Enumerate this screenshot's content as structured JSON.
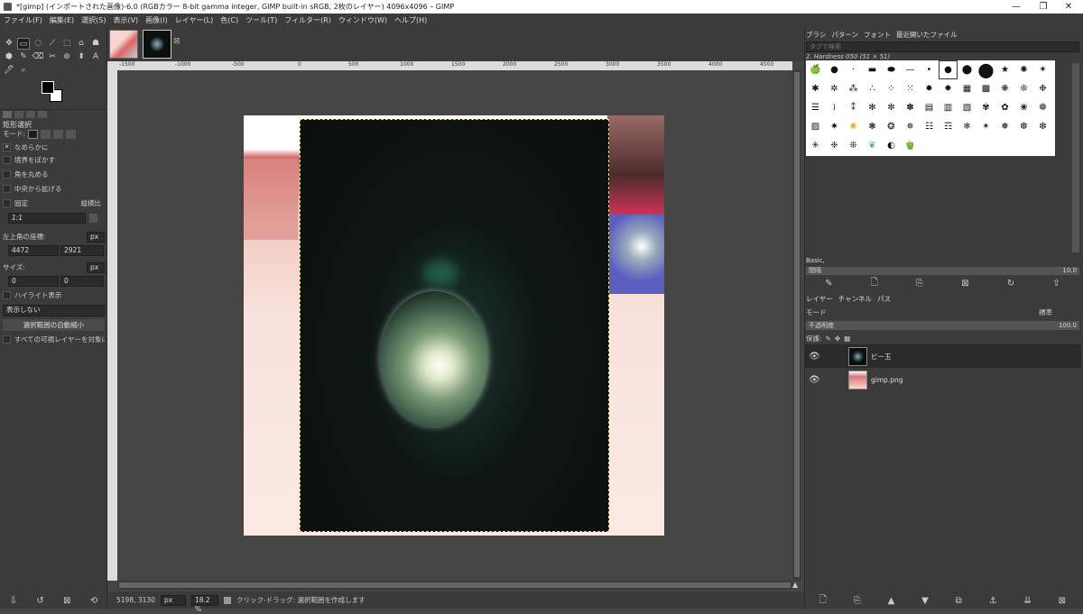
{
  "window": {
    "title": "*[gimp] (インポートされた画像)-6.0 (RGBカラー 8-bit gamma integer, GIMP built-in sRGB, 2枚のレイヤー) 4096x4096 – GIMP",
    "minimize": "—",
    "maximize": "❐",
    "close": "✕"
  },
  "menu": [
    "ファイル(F)",
    "編集(E)",
    "選択(S)",
    "表示(V)",
    "画像(I)",
    "レイヤー(L)",
    "色(C)",
    "ツール(T)",
    "フィルター(R)",
    "ウィンドウ(W)",
    "ヘルプ(H)"
  ],
  "toolbox": {
    "tools": [
      "✥",
      "▭",
      "◌",
      "⟋",
      "⬚",
      "⌂",
      "☗",
      "⬢",
      "✎",
      "⌫",
      "✂",
      "⊛",
      "⬍",
      "A",
      "🖊",
      "⌕"
    ],
    "options_title": "矩形選択",
    "mode_label": "モード:",
    "antialias": "なめらかに",
    "feather": "境界をぼかす",
    "rounded": "角を丸める",
    "expand_center": "中央から拡げる",
    "fixed": "固定",
    "fixed_value": "縦横比",
    "ratio": "1:1",
    "position_label": "左上角の座標:",
    "unit": "px",
    "pos_x": "4472",
    "pos_y": "2921",
    "size_label": "サイズ:",
    "size_w": "0",
    "size_h": "0",
    "highlight": "ハイライト表示",
    "guides": "表示しない",
    "auto_shrink": "選択範囲の自動縮小",
    "sample_merged": "すべての可視レイヤーを対象にす"
  },
  "rulers": {
    "h_ticks": [
      "-1500",
      "-1000",
      "-500",
      "0",
      "500",
      "1000",
      "1500",
      "2000",
      "2500",
      "3000",
      "3500",
      "4000",
      "4500",
      "5000"
    ]
  },
  "status": {
    "coords": "5198, 3130",
    "unit": "px",
    "zoom": "18.2 %",
    "message": "クリック-ドラッグ: 選択範囲を作成します"
  },
  "dock": {
    "tabs": [
      "ブラシ",
      "パターン",
      "フォント",
      "最近開いたファイル"
    ],
    "tag_placeholder": "タグで検索",
    "brush_name": "2. Hardness 050 (51 × 51)",
    "preset": "Basic,",
    "spacing_label": "間隔",
    "spacing_value": "10.0",
    "layer_tabs": [
      "レイヤー",
      "チャンネル",
      "パス"
    ],
    "mode_label": "モード",
    "mode_value": "標準",
    "opacity_label": "不透明度",
    "opacity_value": "100.0",
    "lock_label": "保護:",
    "layers": [
      {
        "name": "ビー玉"
      },
      {
        "name": "gimp.png"
      }
    ]
  },
  "colors": {
    "bg_panel": "#3b3b3b",
    "canvas_bg": "#454545",
    "accent_photo": "#0d1210"
  }
}
